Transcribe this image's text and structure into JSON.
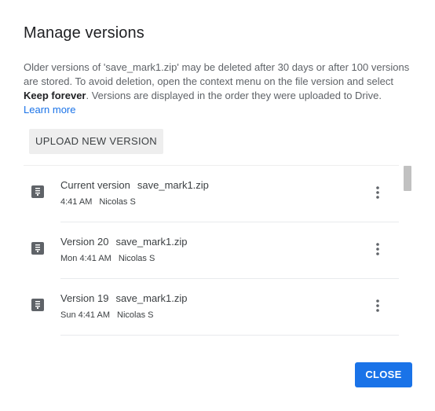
{
  "dialog": {
    "title": "Manage versions",
    "description": {
      "part1": "Older versions of 'save_mark1.zip' may be deleted after 30 days or after 100 versions are stored. To avoid deletion, open the context menu on the file version and select ",
      "keep_forever": "Keep forever",
      "part2": ". Versions are displayed in the order they were uploaded to Drive.",
      "learn_more": "Learn more"
    },
    "upload_button": "UPLOAD NEW VERSION",
    "close_button": "CLOSE"
  },
  "versions": [
    {
      "label": "Current version",
      "file": "save_mark1.zip",
      "time": "4:41 AM",
      "user": "Nicolas S",
      "icon": "zip-file-icon"
    },
    {
      "label": "Version 20",
      "file": "save_mark1.zip",
      "time": "Mon 4:41 AM",
      "user": "Nicolas S",
      "icon": "zip-file-icon"
    },
    {
      "label": "Version 19",
      "file": "save_mark1.zip",
      "time": "Sun 4:41 AM",
      "user": "Nicolas S",
      "icon": "zip-file-icon"
    }
  ],
  "colors": {
    "accent": "#1a73e8",
    "icon_gray": "#5f6368",
    "text_secondary": "#5f6368",
    "button_gray": "#eeeeee"
  }
}
